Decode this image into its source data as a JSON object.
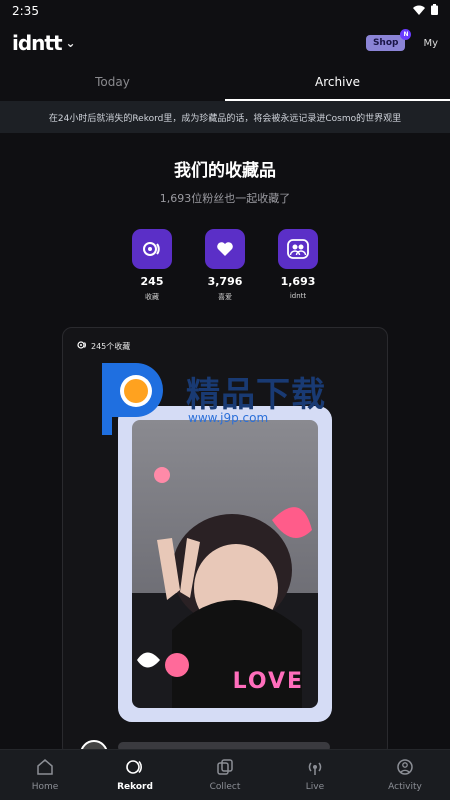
{
  "status": {
    "time": "2:35"
  },
  "header": {
    "logo_text": "idntt",
    "shop_label": "Shop",
    "shop_badge": "N",
    "my_label": "My"
  },
  "tabs": [
    {
      "label": "Today",
      "active": false
    },
    {
      "label": "Archive",
      "active": true
    }
  ],
  "notice": "在24小时后就消失的Rekord里，成为珍藏品的话，将会被永远记录进Cosmo的世界观里",
  "archive": {
    "title": "我们的收藏品",
    "subtitle": "1,693位粉丝也一起收藏了",
    "stats": [
      {
        "icon": "rekord-icon",
        "value": "245",
        "label": "收藏"
      },
      {
        "icon": "heart-icon",
        "value": "3,796",
        "label": "喜爱"
      },
      {
        "icon": "fans-icon",
        "value": "1,693",
        "label": "idntt"
      }
    ]
  },
  "card": {
    "count_label": "245个收藏",
    "sticker_text": "LOVE"
  },
  "watermark": {
    "text": "精品下载",
    "url": "www.j9p.com"
  },
  "bottom_nav": [
    {
      "label": "Home",
      "icon": "home-icon",
      "active": false
    },
    {
      "label": "Rekord",
      "icon": "rekord-icon",
      "active": true
    },
    {
      "label": "Collect",
      "icon": "collect-icon",
      "active": false
    },
    {
      "label": "Live",
      "icon": "live-icon",
      "active": false
    },
    {
      "label": "Activity",
      "icon": "activity-icon",
      "active": false
    }
  ]
}
